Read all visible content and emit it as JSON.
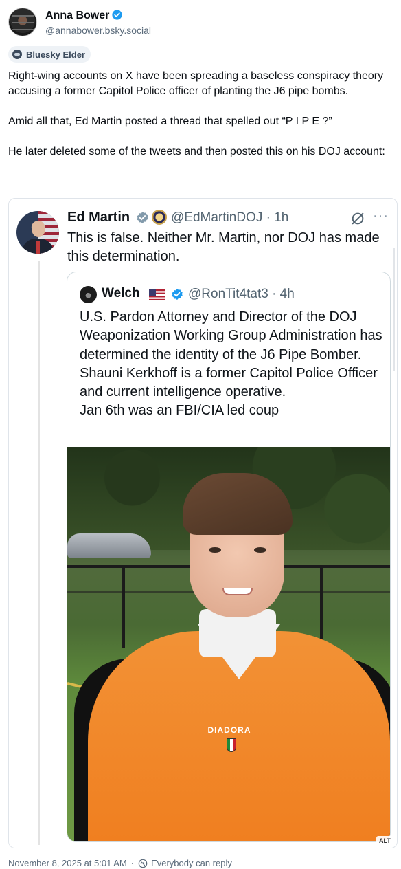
{
  "post": {
    "author": {
      "display_name": "Anna Bower",
      "handle": "@annabower.bsky.social",
      "verified": true,
      "badge_color": "#1d9bf0"
    },
    "label_chip": {
      "text": "Bluesky Elder",
      "icon": "elder-icon"
    },
    "paragraphs": [
      "Right-wing accounts on X have been spreading a baseless conspiracy theory accusing a former Capitol Police officer of planting the J6 pipe bombs.",
      "Amid all that, Ed Martin posted a thread that spelled out “P I P E ?”",
      "He later deleted some of the tweets and then posted this on his DOJ account:"
    ],
    "footer": {
      "timestamp": "November 8, 2025 at 5:01 AM",
      "reply_setting": "Everybody can reply"
    }
  },
  "embedded_tweet": {
    "author": {
      "name": "Ed Martin",
      "handle_time": "@EdMartinDOJ · 1h"
    },
    "text": "This is false. Neither Mr. Martin, nor DOJ has made this determination.",
    "quoted": {
      "author": {
        "name": "Welch",
        "handle_time": "@RonTit4tat3 · 4h"
      },
      "text": "U.S. Pardon Attorney and Director of the DOJ Weaponization Working Group Administration has determined the identity of the J6 Pipe Bomber.\nShauni Kerkhoff is a former Capitol Police Officer and current intelligence operative.\nJan 6th was an FBI/CIA led coup",
      "photo": {
        "jersey_text": "DIADORA"
      }
    },
    "alt_label": "ALT"
  },
  "colors": {
    "text": "#0b0f14",
    "muted": "#5b6b7b",
    "accent": "#1d9bf0",
    "chip_bg": "#eef2f6"
  }
}
